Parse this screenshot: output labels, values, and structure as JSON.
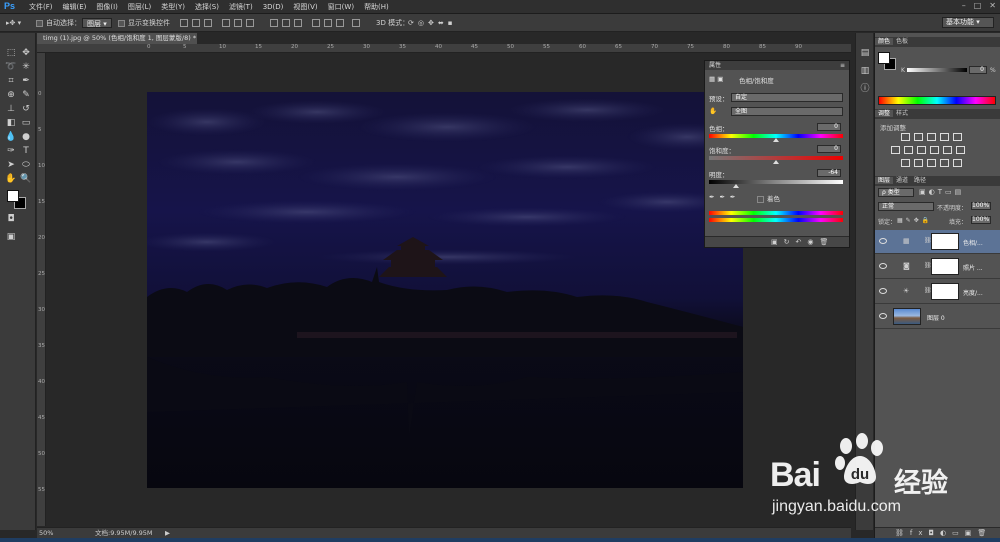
{
  "app": {
    "logo": "Ps"
  },
  "menu": [
    "文件(F)",
    "编辑(E)",
    "图像(I)",
    "图层(L)",
    "类型(Y)",
    "选择(S)",
    "滤镜(T)",
    "3D(D)",
    "视图(V)",
    "窗口(W)",
    "帮助(H)"
  ],
  "window_controls": [
    "–",
    "□",
    "✕"
  ],
  "options": {
    "auto_select_label": "自动选择：",
    "auto_select_value": "图层",
    "show_transform_label": "显示变换控件",
    "mode_3d_label": "3D 模式：",
    "workspace": "基本功能"
  },
  "document": {
    "tab_title": "timg (1).jpg @ 50% (色相/饱和度 1, 图层蒙版/8) *",
    "zoom": "50%",
    "doc_info": "文档:9.95M/9.95M",
    "ruler_marks": [
      "0",
      "5",
      "10",
      "15",
      "20",
      "25",
      "30",
      "35",
      "40",
      "45",
      "50",
      "55",
      "60",
      "65",
      "70",
      "75",
      "80",
      "85",
      "90"
    ]
  },
  "properties": {
    "tab": "属性",
    "title": "色相/饱和度",
    "preset_label": "预设：",
    "preset_value": "自定",
    "channel_value": "全图",
    "hue_label": "色相：",
    "hue_value": "0",
    "saturation_label": "饱和度：",
    "saturation_value": "0",
    "lightness_label": "明度：",
    "lightness_value": "-64",
    "colorize_label": "着色"
  },
  "color_panel": {
    "tabs": [
      "颜色",
      "色板"
    ],
    "k_label": "K",
    "k_value": "0",
    "unit": "%"
  },
  "adjustments_panel": {
    "tabs": [
      "调整",
      "样式"
    ],
    "add_label": "添加调整"
  },
  "layers_panel": {
    "tabs": [
      "图层",
      "通道",
      "路径"
    ],
    "kind_filter": "ρ 类型",
    "blend_mode": "正常",
    "opacity_label": "不透明度：",
    "opacity_value": "100%",
    "lock_label": "锁定：",
    "fill_label": "填充：",
    "fill_value": "100%",
    "layers": [
      {
        "name": "色相/...",
        "selected": true
      },
      {
        "name": "照片 ...",
        "selected": false
      },
      {
        "name": "亮度/...",
        "selected": false
      },
      {
        "name": "图层 0",
        "selected": false
      }
    ]
  },
  "watermark": {
    "brand": "Bai",
    "brand2": "du",
    "cn": "经验",
    "url": "jingyan.baidu.com"
  }
}
